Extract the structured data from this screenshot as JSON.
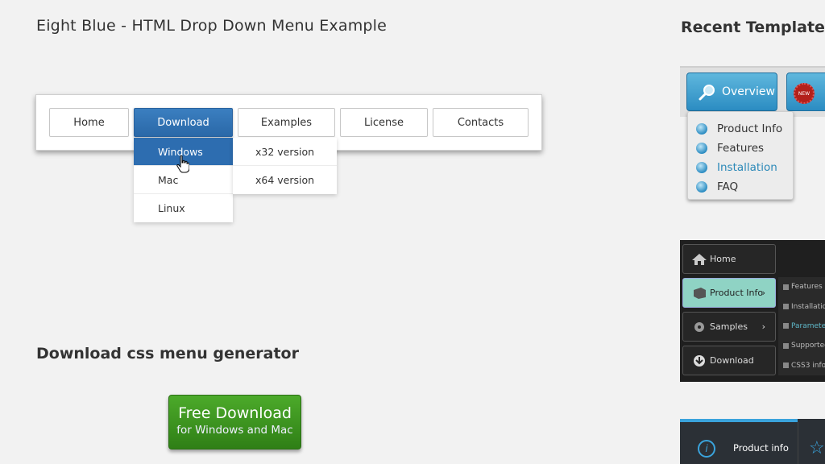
{
  "headings": {
    "title": "Eight Blue - HTML Drop Down Menu Example",
    "generator": "Download css menu generator",
    "recent": "Recent Templates"
  },
  "menu": {
    "items": [
      "Home",
      "Download",
      "Examples",
      "License",
      "Contacts"
    ],
    "active_item": "Download",
    "download_dropdown": [
      "Windows",
      "Mac",
      "Linux"
    ],
    "windows_submenu": [
      "x32 version",
      "x64 version"
    ]
  },
  "download_button": {
    "main": "Free Download",
    "sub": "for Windows and Mac"
  },
  "template1": {
    "tab": "Overview",
    "badge": "NEW",
    "items": [
      "Product Info",
      "Features",
      "Installation",
      "FAQ"
    ]
  },
  "template2": {
    "items": [
      "Home",
      "Product Info",
      "Samples",
      "Download"
    ],
    "submenu": [
      "Features",
      "Installation",
      "Parameters",
      "Supported",
      "CSS3 info"
    ]
  },
  "template3": {
    "label": "Product info"
  },
  "colors": {
    "menu_active": "#2d6db0",
    "download_green": "#3e9420",
    "template1_blue": "#2b8cc2",
    "template2_active": "#8fd3c4",
    "template3_accent": "#3aa3dc"
  }
}
